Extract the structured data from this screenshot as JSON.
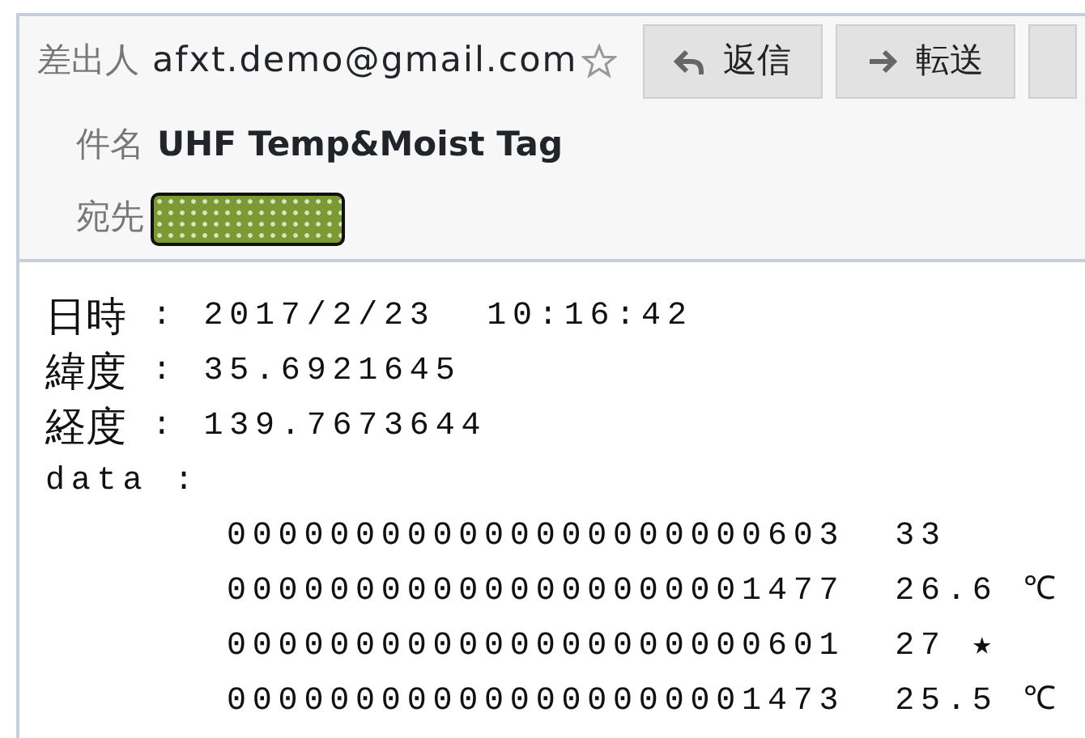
{
  "header": {
    "from_label": "差出人",
    "from": "afxt.demo@gmail.com",
    "buttons": [
      {
        "label": "返信",
        "kind": "reply"
      },
      {
        "label": "転送",
        "kind": "forward"
      },
      {
        "kind": "more"
      }
    ],
    "subject_label": "件名",
    "subject": "UHF Temp&Moist Tag",
    "to_label": "宛先"
  },
  "body": {
    "fields": [
      {
        "label": "日時",
        "value": ": 2017/2/23  10:16:42"
      },
      {
        "label": "緯度",
        "value": ": 35.6921645"
      },
      {
        "label": "経度",
        "value": ": 139.7673644"
      }
    ],
    "data_label": "data :",
    "rows": [
      {
        "id": "000000000000000000000603",
        "value": "33"
      },
      {
        "id": "000000000000000000001477",
        "value": "26.6 ℃"
      },
      {
        "id": "000000000000000000000601",
        "value": "27 ★"
      },
      {
        "id": "000000000000000000001473",
        "value": "25.5 ℃"
      }
    ]
  }
}
